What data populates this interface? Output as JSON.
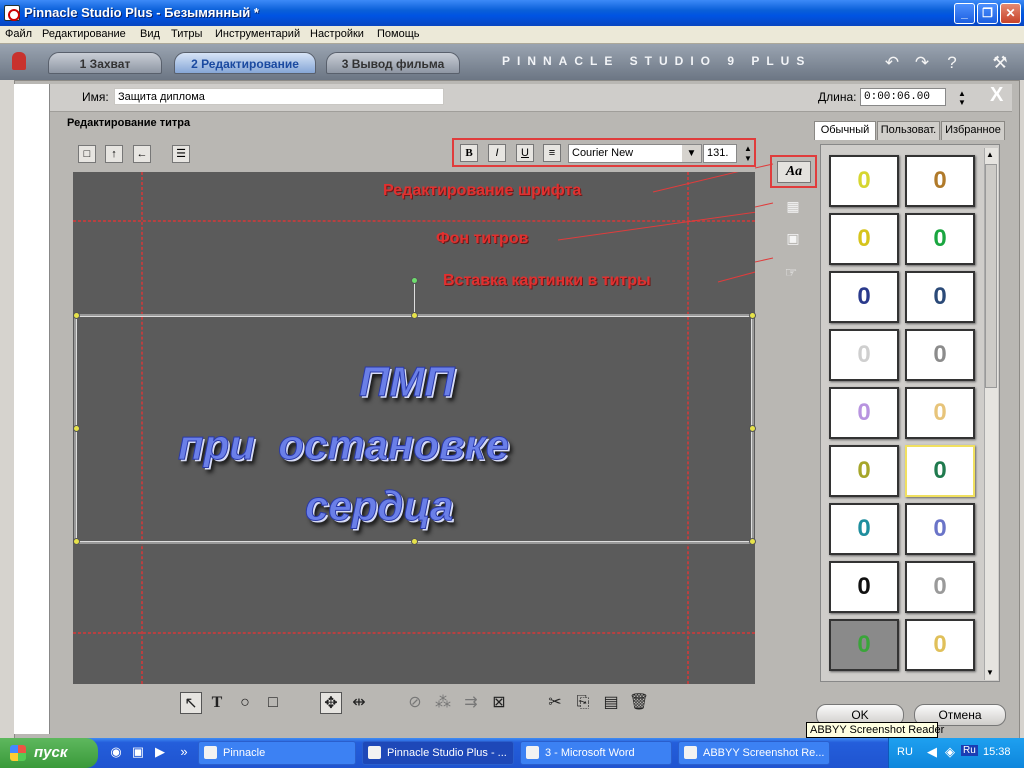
{
  "window": {
    "title": "Pinnacle Studio Plus - Безымянный *"
  },
  "menu": [
    "Файл",
    "Редактирование",
    "Вид",
    "Титры",
    "Инструментарий",
    "Настройки",
    "Помощь"
  ],
  "modes": [
    {
      "label": "1 Захват"
    },
    {
      "label": "2 Редактирование",
      "active": true
    },
    {
      "label": "3 Вывод фильма"
    }
  ],
  "brand": "PINNACLE STUDIO 9 PLUS",
  "editor": {
    "name_label": "Имя:",
    "name_value": "Защита диплома",
    "duration_label": "Длина:",
    "duration_value": "0:00:06.00",
    "section_title": "Редактирование титра",
    "close": "X"
  },
  "format": {
    "bold": "B",
    "italic": "I",
    "underline": "U",
    "font": "Courier New",
    "size": "131."
  },
  "annotations": [
    "Редактирование шрифта",
    "Фон титров",
    "Вставка картинки в титры"
  ],
  "title_lines": [
    "ПМП",
    "при  остановке",
    "сердца"
  ],
  "side_buttons": {
    "font_style": "Aa"
  },
  "style_tabs": [
    "Обычный",
    "Пользоват.",
    "Избранное"
  ],
  "style_thumb_glyph": "0",
  "style_thumbs": [
    {
      "color": "#d6d630",
      "bg": "#ffffff"
    },
    {
      "color": "#b07a2a",
      "bg": "#ffffff"
    },
    {
      "color": "#d6c41c",
      "bg": "#ffffff"
    },
    {
      "color": "#1aa640",
      "bg": "#ffffff"
    },
    {
      "color": "#2a3a8c",
      "bg": "#ffffff"
    },
    {
      "color": "#2b4a78",
      "bg": "#ffffff"
    },
    {
      "color": "#cfcfcf",
      "bg": "#ffffff"
    },
    {
      "color": "#8c8c8c",
      "bg": "#ffffff"
    },
    {
      "color": "#b894e0",
      "bg": "#ffffff"
    },
    {
      "color": "#e7c47a",
      "bg": "#ffffff"
    },
    {
      "color": "#a6a62a",
      "bg": "#ffffff"
    },
    {
      "color": "#1f7a4e",
      "bg": "#ffffff",
      "selected": true
    },
    {
      "color": "#1f8e9e",
      "bg": "#ffffff"
    },
    {
      "color": "#6a74c8",
      "bg": "#ffffff"
    },
    {
      "color": "#111111",
      "bg": "#ffffff"
    },
    {
      "color": "#9a9a9a",
      "bg": "#ffffff"
    },
    {
      "color": "#3aa53a",
      "bg": "#8a8a8a"
    },
    {
      "color": "#e0c05a",
      "bg": "#ffffff"
    }
  ],
  "buttons": {
    "ok": "OK",
    "cancel": "Отмена"
  },
  "tooltip": "ABBYY Screenshot Reader",
  "taskbar": {
    "start": "пуск",
    "tasks": [
      {
        "label": "Pinnacle"
      },
      {
        "label": "Pinnacle Studio Plus - ...",
        "active": true
      },
      {
        "label": "3 - Microsoft Word"
      },
      {
        "label": "ABBYY Screenshot Re..."
      }
    ],
    "lang": "RU",
    "lang2": "Ru",
    "clock": "15:38"
  }
}
